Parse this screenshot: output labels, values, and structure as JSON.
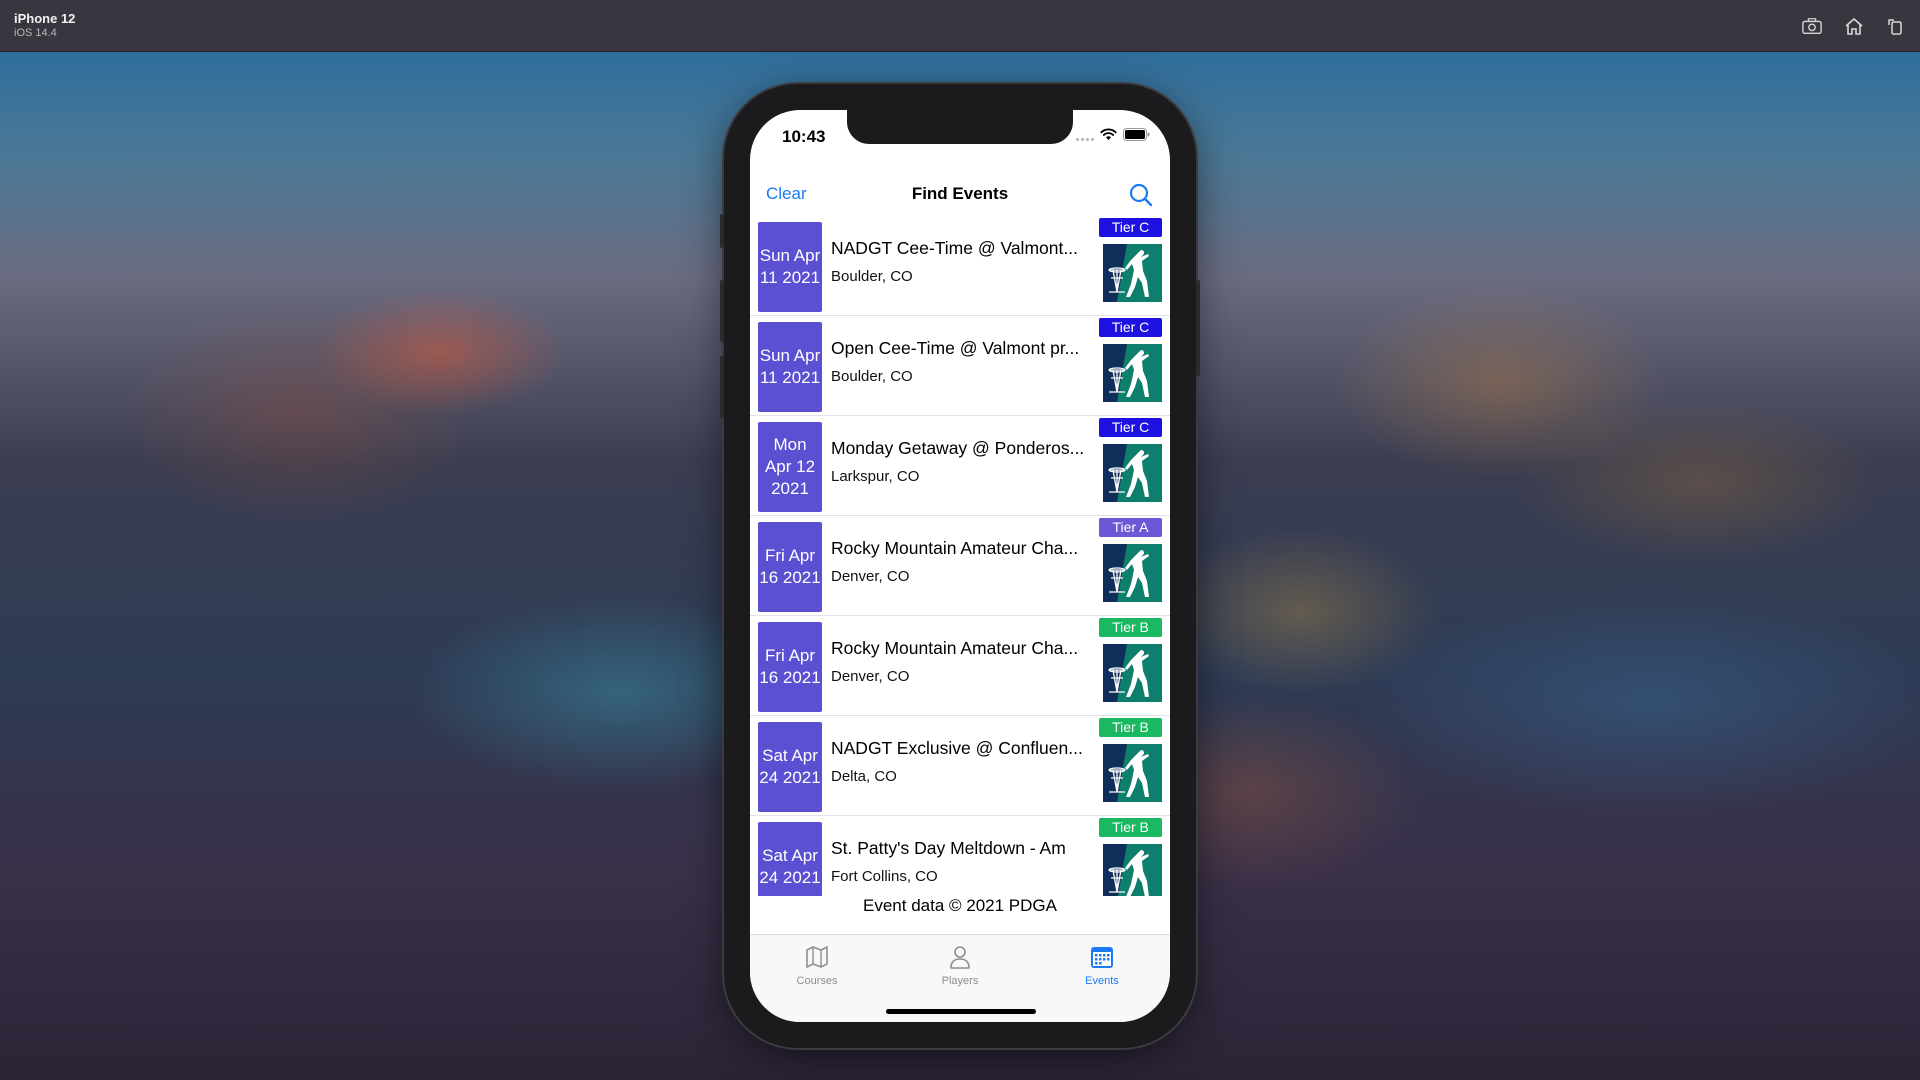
{
  "simulator": {
    "device": "iPhone 12",
    "os": "iOS 14.4",
    "tools": [
      "screenshot-icon",
      "home-icon",
      "rotate-icon"
    ]
  },
  "status_bar": {
    "time": "10:43"
  },
  "nav": {
    "left_button": "Clear",
    "title": "Find Events",
    "right_icon": "search-icon"
  },
  "colors": {
    "accent": "#1a7cf5",
    "date_tile": "#5b4fd2",
    "tier_a": "#6a58d6",
    "tier_b": "#19b861",
    "tier_c": "#1d12e0"
  },
  "events": [
    {
      "date": "Sun Apr 11 2021",
      "name": "NADGT Cee-Time @ Valmont...",
      "location": "Boulder, CO",
      "tier": "Tier C"
    },
    {
      "date": "Sun Apr 11 2021",
      "name": "Open Cee-Time @ Valmont pr...",
      "location": "Boulder, CO",
      "tier": "Tier C"
    },
    {
      "date": "Mon Apr 12 2021",
      "name": "Monday Getaway @ Ponderos...",
      "location": "Larkspur, CO",
      "tier": "Tier C"
    },
    {
      "date": "Fri Apr 16 2021",
      "name": "Rocky Mountain Amateur Cha...",
      "location": "Denver, CO",
      "tier": "Tier A"
    },
    {
      "date": "Fri Apr 16 2021",
      "name": "Rocky Mountain Amateur Cha...",
      "location": "Denver, CO",
      "tier": "Tier B"
    },
    {
      "date": "Sat Apr 24 2021",
      "name": "NADGT Exclusive @ Confluen...",
      "location": "Delta, CO",
      "tier": "Tier B"
    },
    {
      "date": "Sat Apr 24 2021",
      "name": "St. Patty's Day Meltdown - Am",
      "location": "Fort Collins, CO",
      "tier": "Tier B"
    }
  ],
  "footer_note": "Event data © 2021 PDGA",
  "tabs": [
    {
      "label": "Courses",
      "icon": "map-icon",
      "active": false
    },
    {
      "label": "Players",
      "icon": "person-icon",
      "active": false
    },
    {
      "label": "Events",
      "icon": "calendar-icon",
      "active": true
    }
  ]
}
